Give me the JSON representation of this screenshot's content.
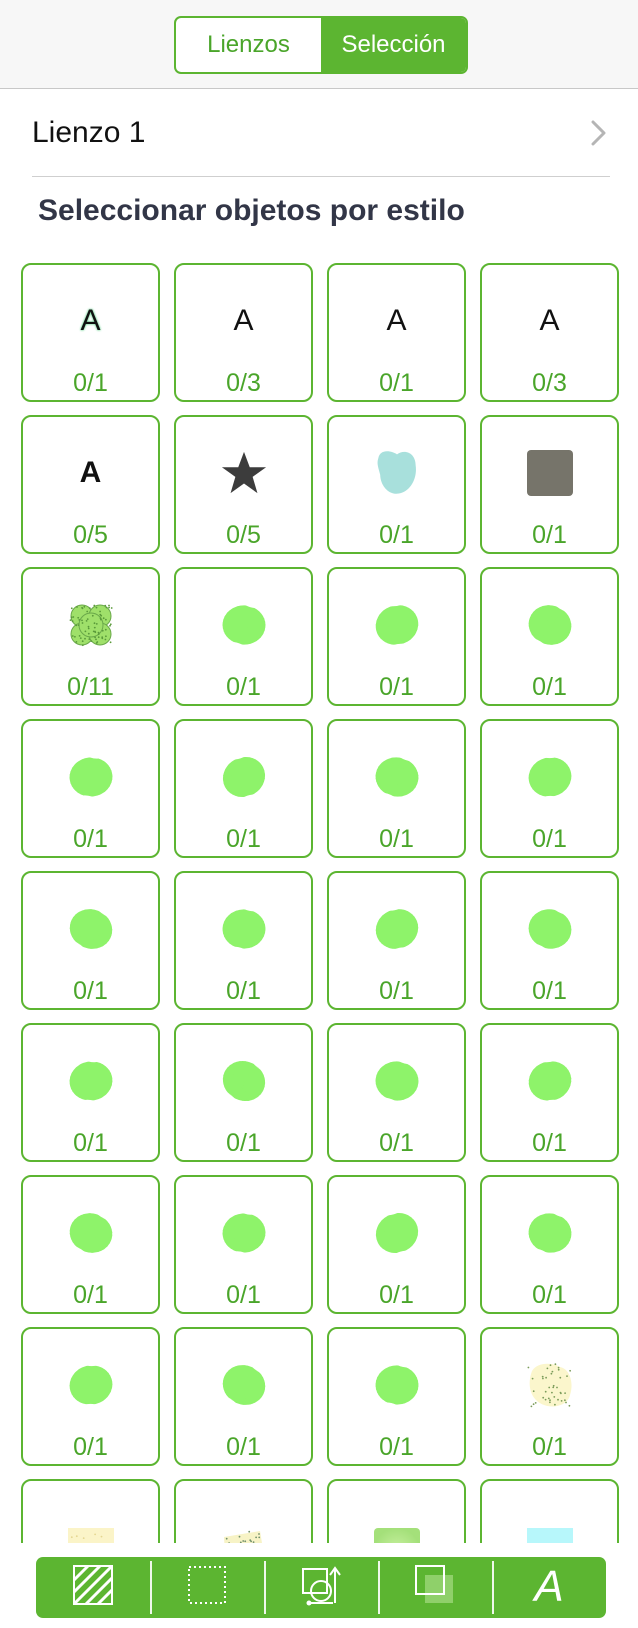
{
  "segmented": {
    "tab_canvases": "Lienzos",
    "tab_selection": "Selección",
    "active": "Selección"
  },
  "canvas": {
    "name": "Lienzo 1"
  },
  "section_title": "Seleccionar objetos por estilo",
  "colors": {
    "accent": "#5cb531",
    "accent_text": "#4aa52a",
    "scribble": "#8ef36a",
    "shape_teal": "#a8e0dc",
    "shape_gray": "#76746a",
    "star": "#3c3c3c"
  },
  "styles": [
    {
      "icon": "text-a-icon",
      "kind": "textA",
      "variant": "halo",
      "count": "0/1"
    },
    {
      "icon": "text-a-icon",
      "kind": "textA",
      "variant": "plain",
      "count": "0/3"
    },
    {
      "icon": "text-a-icon",
      "kind": "textA",
      "variant": "plain",
      "count": "0/1"
    },
    {
      "icon": "text-a-icon",
      "kind": "textA",
      "variant": "plain",
      "count": "0/3"
    },
    {
      "icon": "text-a-icon",
      "kind": "textA",
      "variant": "bold",
      "count": "0/5"
    },
    {
      "icon": "star-icon",
      "kind": "star",
      "count": "0/5"
    },
    {
      "icon": "blob-shape-icon",
      "kind": "blob",
      "count": "0/1"
    },
    {
      "icon": "rounded-square-icon",
      "kind": "square",
      "count": "0/1"
    },
    {
      "icon": "flower-texture-icon",
      "kind": "flower",
      "count": "0/11"
    },
    {
      "icon": "green-scribble-icon",
      "kind": "scribble",
      "count": "0/1"
    },
    {
      "icon": "green-scribble-icon",
      "kind": "scribble",
      "count": "0/1"
    },
    {
      "icon": "green-scribble-icon",
      "kind": "scribble",
      "count": "0/1"
    },
    {
      "icon": "green-scribble-icon",
      "kind": "scribble",
      "count": "0/1"
    },
    {
      "icon": "green-scribble-icon",
      "kind": "scribble",
      "count": "0/1"
    },
    {
      "icon": "green-scribble-icon",
      "kind": "scribble",
      "count": "0/1"
    },
    {
      "icon": "green-scribble-icon",
      "kind": "scribble",
      "count": "0/1"
    },
    {
      "icon": "green-scribble-icon",
      "kind": "scribble",
      "count": "0/1"
    },
    {
      "icon": "green-scribble-icon",
      "kind": "scribble",
      "count": "0/1"
    },
    {
      "icon": "green-scribble-icon",
      "kind": "scribble",
      "count": "0/1"
    },
    {
      "icon": "green-scribble-icon",
      "kind": "scribble",
      "count": "0/1"
    },
    {
      "icon": "green-scribble-icon",
      "kind": "scribble",
      "count": "0/1"
    },
    {
      "icon": "green-scribble-icon",
      "kind": "scribble",
      "count": "0/1"
    },
    {
      "icon": "green-scribble-icon",
      "kind": "scribble",
      "count": "0/1"
    },
    {
      "icon": "green-scribble-icon",
      "kind": "scribble",
      "count": "0/1"
    },
    {
      "icon": "green-scribble-icon",
      "kind": "scribble",
      "count": "0/1"
    },
    {
      "icon": "green-scribble-icon",
      "kind": "scribble",
      "count": "0/1"
    },
    {
      "icon": "green-scribble-icon",
      "kind": "scribble",
      "count": "0/1"
    },
    {
      "icon": "green-scribble-icon",
      "kind": "scribble",
      "count": "0/1"
    },
    {
      "icon": "green-scribble-icon",
      "kind": "scribble",
      "count": "0/1"
    },
    {
      "icon": "green-scribble-icon",
      "kind": "scribble",
      "count": "0/1"
    },
    {
      "icon": "green-scribble-icon",
      "kind": "scribble",
      "count": "0/1"
    },
    {
      "icon": "speckled-blob-icon",
      "kind": "speckle",
      "count": "0/1"
    },
    {
      "icon": "pale-yellow-texture-icon",
      "kind": "paleRect",
      "count": ""
    },
    {
      "icon": "speckled-yellow-icon",
      "kind": "speckleRect",
      "count": ""
    },
    {
      "icon": "green-gradient-icon",
      "kind": "greenRect",
      "count": ""
    },
    {
      "icon": "cyan-rectangle-icon",
      "kind": "cyanRect",
      "count": ""
    }
  ],
  "toolbar": {
    "items": [
      {
        "icon": "fill-style-icon"
      },
      {
        "icon": "stroke-style-icon"
      },
      {
        "icon": "geometry-icon"
      },
      {
        "icon": "shadow-icon"
      },
      {
        "icon": "text-style-icon"
      }
    ]
  }
}
